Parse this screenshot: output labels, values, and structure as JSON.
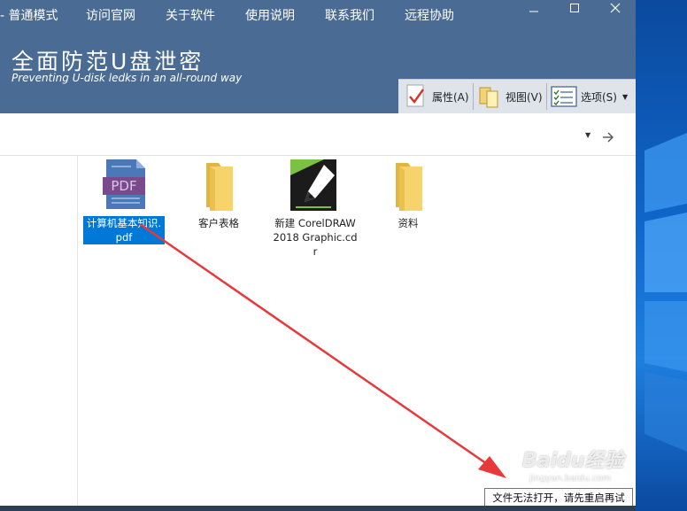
{
  "menu": {
    "mode": "- 普通模式",
    "items": [
      "访问官网",
      "关于软件",
      "使用说明",
      "联系我们",
      "远程协助"
    ]
  },
  "app": {
    "title": "全面防范U盘泄密",
    "subtitle": "Preventing U-disk ledks in an all-round way"
  },
  "toolbar": {
    "properties": "属性(A)",
    "view": "视图(V)",
    "options": "选项(S)"
  },
  "files": [
    {
      "name": "计算机基本知识.pdf",
      "icon": "pdf-file-icon",
      "selected": true
    },
    {
      "name": "客户表格",
      "icon": "folder-icon",
      "selected": false
    },
    {
      "name": "新建 CorelDRAW 2018 Graphic.cdr",
      "icon": "coreldraw-file-icon",
      "selected": false
    },
    {
      "name": "资料",
      "icon": "folder-icon",
      "selected": false
    }
  ],
  "status": {
    "message": "文件无法打开，请先重启再试"
  },
  "watermark": {
    "brand": "Baidu经验",
    "url": "jingyan.baidu.com"
  },
  "colors": {
    "header": "#4a6b94",
    "selection": "#0078d7",
    "arrow": "#e8393a"
  }
}
